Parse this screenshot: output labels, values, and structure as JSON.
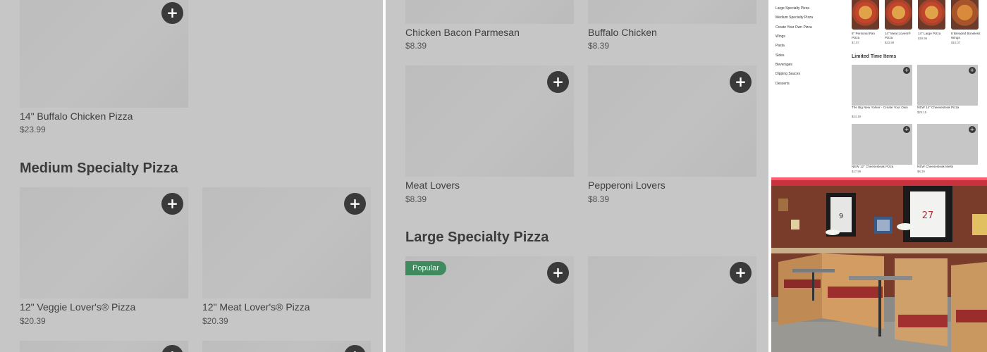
{
  "panel_a": {
    "top_item": {
      "name": "14\" Buffalo Chicken Pizza",
      "price": "$23.99"
    },
    "section_title": "Medium Specialty Pizza",
    "items": [
      {
        "name": "12\" Veggie Lover's® Pizza",
        "price": "$20.39"
      },
      {
        "name": "12\" Meat Lover's® Pizza",
        "price": "$20.39"
      }
    ],
    "add_symbol": "+"
  },
  "panel_b": {
    "top_items": [
      {
        "name": "Chicken Bacon Parmesan",
        "price": "$8.39"
      },
      {
        "name": "Buffalo Chicken",
        "price": "$8.39"
      }
    ],
    "mid_items": [
      {
        "name": "Meat Lovers",
        "price": "$8.39"
      },
      {
        "name": "Pepperoni Lovers",
        "price": "$8.39"
      }
    ],
    "section_title": "Large Specialty Pizza",
    "badge": "Popular",
    "add_symbol": "+"
  },
  "panel_c": {
    "sidebar": [
      "Large Specialty Pizza",
      "Medium Specialty Pizza",
      "Create Your Own Pizza",
      "Wings",
      "Pasta",
      "Sides",
      "Beverages",
      "Dipping Sauces",
      "Desserts"
    ],
    "thumbs": [
      {
        "name": "6\" Personal Pan Pizza",
        "price": "$7.07"
      },
      {
        "name": "14\" Meat Lovers® Pizza",
        "price": "$23.99"
      },
      {
        "name": "14\" Large Pizza",
        "price": "$19.95"
      },
      {
        "name": "8 Breaded Boneless Wings",
        "price": "$10.07"
      }
    ],
    "section_title": "Limited Time Items",
    "cards": [
      {
        "name": "The Big New Yorker - Create Your Own",
        "price": "$24.19"
      },
      {
        "name": "NEW 14\" Cheesesteak Pizza",
        "price": "$20.15"
      },
      {
        "name": "NEW 12\" Cheesesteak Pizza",
        "price": "$17.99"
      },
      {
        "name": "NEW Cheesesteak Melts",
        "price": "$8.39"
      }
    ],
    "add_symbol": "+"
  },
  "panel_d": {
    "jersey_numbers": [
      "9",
      "27"
    ]
  },
  "colors": {
    "panel_overlay": "#c6c6c6",
    "button": "#3a3a3a",
    "badge": "#3f8a5e"
  }
}
